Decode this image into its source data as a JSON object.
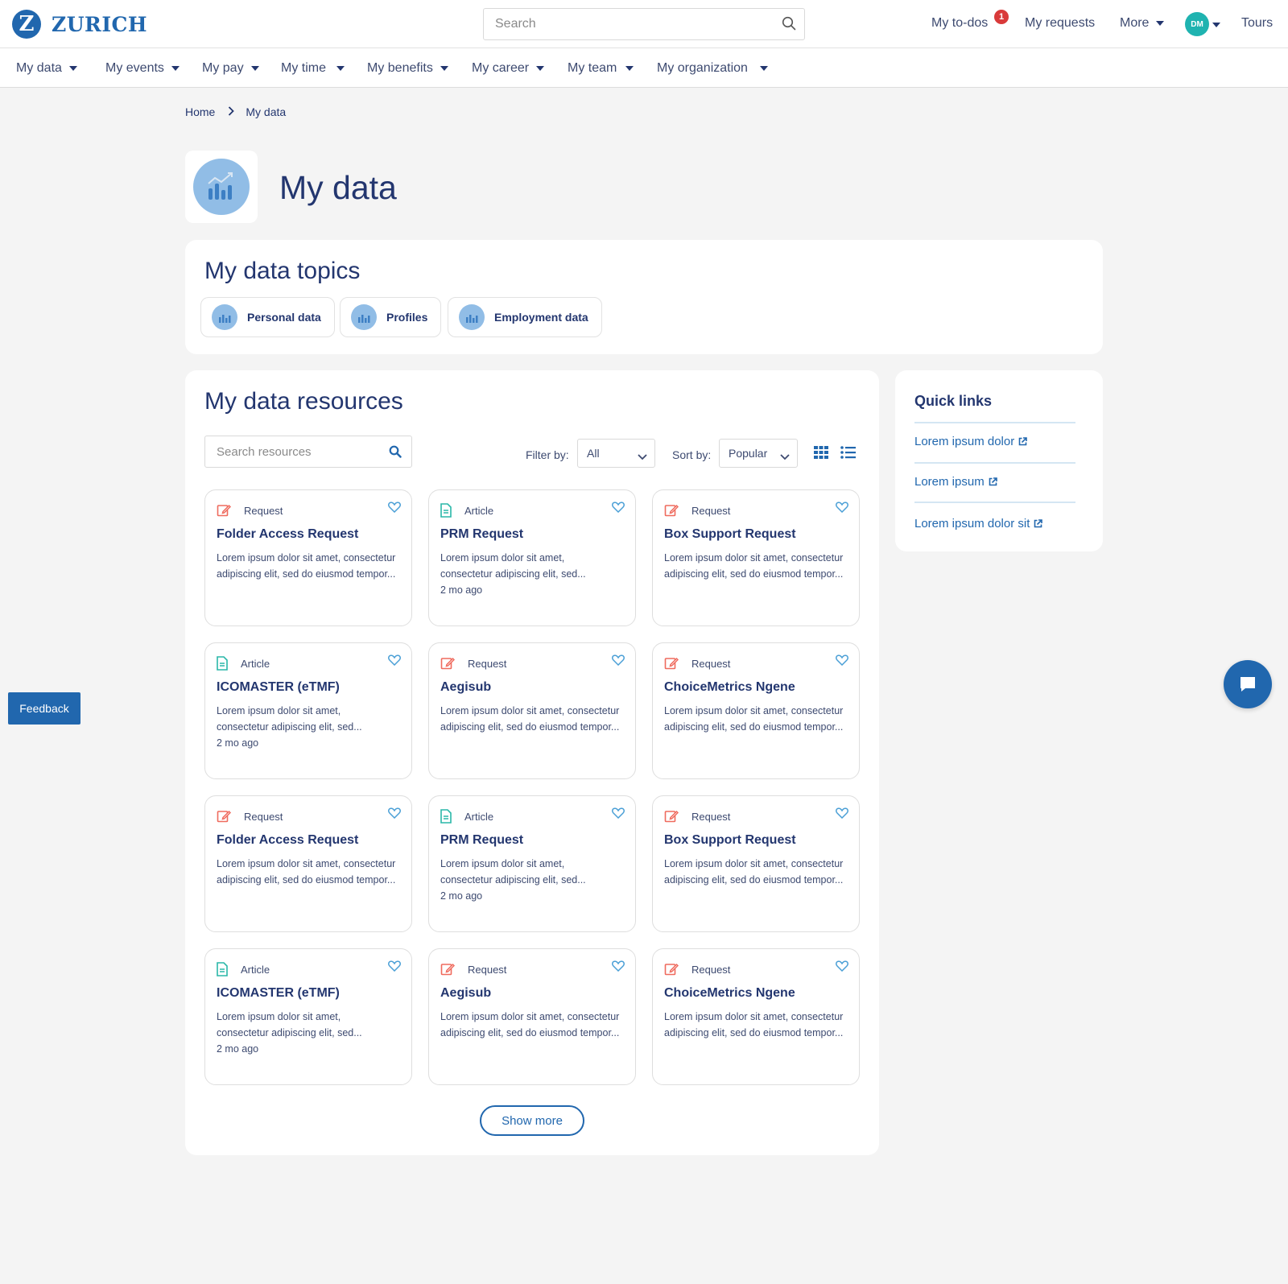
{
  "brand": {
    "name": "ZURICH",
    "logo_letter": "Z",
    "color": "#2167ae"
  },
  "header": {
    "search_placeholder": "Search",
    "todos_label": "My to-dos",
    "todos_count": "1",
    "requests_label": "My requests",
    "more_label": "More",
    "avatar_initials": "DM",
    "tours_label": "Tours"
  },
  "subnav": [
    {
      "label": "My data"
    },
    {
      "label": "My events"
    },
    {
      "label": "My pay"
    },
    {
      "label": "My time"
    },
    {
      "label": "My benefits"
    },
    {
      "label": "My career"
    },
    {
      "label": "My team"
    },
    {
      "label": "My organization"
    }
  ],
  "breadcrumb": {
    "home": "Home",
    "current": "My data"
  },
  "page": {
    "title": "My data",
    "icon": "chart-icon"
  },
  "topics": {
    "title": "My data topics",
    "items": [
      {
        "label": "Personal data",
        "icon": "chart-icon"
      },
      {
        "label": "Profiles",
        "icon": "chart-icon"
      },
      {
        "label": "Employment data",
        "icon": "chart-icon"
      }
    ]
  },
  "resources": {
    "title": "My data resources",
    "search_placeholder": "Search resources",
    "filter_label": "Filter by:",
    "filter_value": "All",
    "sort_label": "Sort by:",
    "sort_value": "Popular",
    "cards": [
      {
        "type": "Request",
        "title": "Folder Access Request",
        "desc": "Lorem ipsum dolor sit amet, consectetur adipiscing elit, sed do eiusmod tempor...",
        "meta": ""
      },
      {
        "type": "Article",
        "title": "PRM Request",
        "desc": "Lorem ipsum dolor sit amet, consectetur adipiscing elit, sed...",
        "meta": "2 mo ago"
      },
      {
        "type": "Request",
        "title": "Box Support Request",
        "desc": "Lorem ipsum dolor sit amet, consectetur adipiscing elit, sed do eiusmod tempor...",
        "meta": ""
      },
      {
        "type": "Article",
        "title": "ICOMASTER (eTMF)",
        "desc": "Lorem ipsum dolor sit amet, consectetur adipiscing elit, sed...",
        "meta": "2 mo ago"
      },
      {
        "type": "Request",
        "title": "Aegisub",
        "desc": "Lorem ipsum dolor sit amet, consectetur adipiscing elit, sed do eiusmod tempor...",
        "meta": ""
      },
      {
        "type": "Request",
        "title": "ChoiceMetrics Ngene",
        "desc": "Lorem ipsum dolor sit amet, consectetur adipiscing elit, sed do eiusmod tempor...",
        "meta": ""
      },
      {
        "type": "Request",
        "title": "Folder Access Request",
        "desc": "Lorem ipsum dolor sit amet, consectetur adipiscing elit, sed do eiusmod tempor...",
        "meta": ""
      },
      {
        "type": "Article",
        "title": "PRM Request",
        "desc": "Lorem ipsum dolor sit amet, consectetur adipiscing elit, sed...",
        "meta": "2 mo ago"
      },
      {
        "type": "Request",
        "title": "Box Support Request",
        "desc": "Lorem ipsum dolor sit amet, consectetur adipiscing elit, sed do eiusmod tempor...",
        "meta": ""
      },
      {
        "type": "Article",
        "title": "ICOMASTER (eTMF)",
        "desc": "Lorem ipsum dolor sit amet, consectetur adipiscing elit, sed...",
        "meta": "2 mo ago"
      },
      {
        "type": "Request",
        "title": "Aegisub",
        "desc": "Lorem ipsum dolor sit amet, consectetur adipiscing elit, sed do eiusmod tempor...",
        "meta": ""
      },
      {
        "type": "Request",
        "title": "ChoiceMetrics Ngene",
        "desc": "Lorem ipsum dolor sit amet, consectetur adipiscing elit, sed do eiusmod tempor...",
        "meta": ""
      }
    ],
    "show_more_label": "Show more"
  },
  "quick_links": {
    "title": "Quick links",
    "items": [
      {
        "label": "Lorem ipsum dolor"
      },
      {
        "label": "Lorem ipsum"
      },
      {
        "label": "Lorem ipsum dolor sit"
      }
    ]
  },
  "feedback_label": "Feedback",
  "colors": {
    "primary": "#2167ae",
    "navy": "#23366f",
    "request_icon": "#ef6b5e",
    "article_icon": "#2ab7a9",
    "badge": "#d93a3a",
    "avatar": "#1fb3b0",
    "icon_bg": "#91bde6"
  }
}
